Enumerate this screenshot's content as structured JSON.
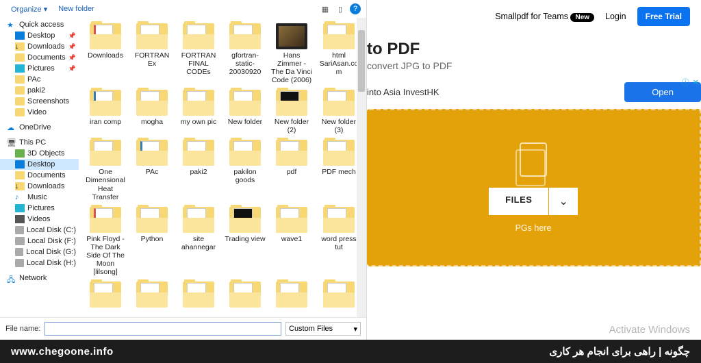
{
  "dialog": {
    "organize": "Organize ▾",
    "new_folder": "New folder",
    "filename_label": "File name:",
    "filename_value": "",
    "filetype": "Custom Files"
  },
  "sidebar": {
    "quick": {
      "label": "Quick access"
    },
    "quick_items": [
      {
        "label": "Desktop",
        "pin": true,
        "icon": "desktop"
      },
      {
        "label": "Downloads",
        "pin": true,
        "icon": "down"
      },
      {
        "label": "Documents",
        "pin": true,
        "icon": "doc"
      },
      {
        "label": "Pictures",
        "pin": true,
        "icon": "pic"
      },
      {
        "label": "PAc",
        "icon": "folder"
      },
      {
        "label": "paki2",
        "icon": "folder"
      },
      {
        "label": "Screenshots",
        "icon": "folder"
      },
      {
        "label": "Video",
        "icon": "folder"
      }
    ],
    "onedrive": "OneDrive",
    "thispc": "This PC",
    "pc_items": [
      {
        "label": "3D Objects",
        "icon": "3d"
      },
      {
        "label": "Desktop",
        "icon": "desktop",
        "selected": true
      },
      {
        "label": "Documents",
        "icon": "doc"
      },
      {
        "label": "Downloads",
        "icon": "down"
      },
      {
        "label": "Music",
        "icon": "music"
      },
      {
        "label": "Pictures",
        "icon": "pic"
      },
      {
        "label": "Videos",
        "icon": "vid"
      },
      {
        "label": "Local Disk (C:)",
        "icon": "disk"
      },
      {
        "label": "Local Disk (F:)",
        "icon": "disk"
      },
      {
        "label": "Local Disk (G:)",
        "icon": "disk"
      },
      {
        "label": "Local Disk (H:)",
        "icon": "disk"
      }
    ],
    "network": "Network"
  },
  "files": [
    {
      "label": "Downloads",
      "t": "doc-red"
    },
    {
      "label": "FORTRAN Ex",
      "t": ""
    },
    {
      "label": "FORTRAN FINAL CODEs",
      "t": ""
    },
    {
      "label": "gfortran-static-20030920",
      "t": ""
    },
    {
      "label": "Hans Zimmer - The Da Vinci Code (2006)",
      "t": "image"
    },
    {
      "label": "html SariAsan.com",
      "t": ""
    },
    {
      "label": "iran comp",
      "t": "doc-blue"
    },
    {
      "label": "mogha",
      "t": ""
    },
    {
      "label": "my own pic",
      "t": ""
    },
    {
      "label": "New folder",
      "t": ""
    },
    {
      "label": "New folder (2)",
      "t": "dark"
    },
    {
      "label": "New folder (3)",
      "t": ""
    },
    {
      "label": "One Dimensional Heat Transfer",
      "t": ""
    },
    {
      "label": "PAc",
      "t": "doc-blue"
    },
    {
      "label": "paki2",
      "t": ""
    },
    {
      "label": "pakilon goods",
      "t": ""
    },
    {
      "label": "pdf",
      "t": ""
    },
    {
      "label": "PDF mech",
      "t": ""
    },
    {
      "label": "Pink Floyd - The Dark Side Of The Moon [lilsong]",
      "t": "doc-red"
    },
    {
      "label": "Python",
      "t": ""
    },
    {
      "label": "site ahannegar",
      "t": ""
    },
    {
      "label": "Trading view",
      "t": "dark"
    },
    {
      "label": "wave1",
      "t": ""
    },
    {
      "label": "word press tut",
      "t": ""
    }
  ],
  "page": {
    "teams": "Smallpdf for Teams",
    "badge": "New",
    "login": "Login",
    "trial": "Free Trial",
    "title": "to PDF",
    "subtitle": "convert JPG to PDF",
    "ad_text": "into Asia InvestHK",
    "ad_open": "Open",
    "ad_marker": "ⓘ ✕",
    "choose": "FILES",
    "drop_hint": "PGs here",
    "activate": "Activate Windows"
  },
  "footer": {
    "left": "www.chegoone.info",
    "right": "چگونه | راهی برای انجام هر کاری"
  }
}
